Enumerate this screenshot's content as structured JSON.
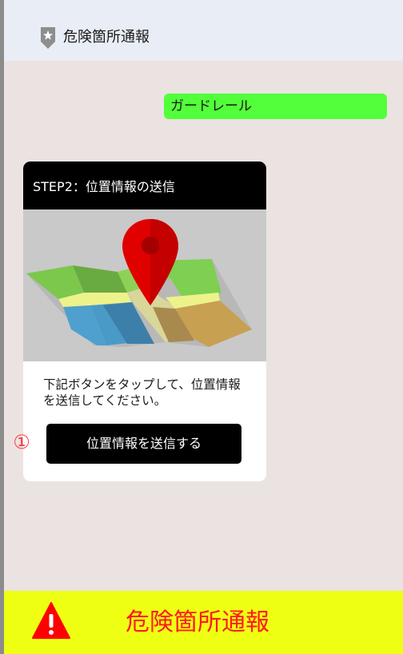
{
  "header": {
    "icon": "location-pin-star-icon",
    "title": "危険箇所通報"
  },
  "chat": {
    "message": "ガードレール"
  },
  "card": {
    "title": "STEP2：位置情報の送信",
    "image": "map-with-location-pin-illustration",
    "body_text": "下記ボタンをタップして、位置情報を送信してください。",
    "button_label": "位置情報を送信する"
  },
  "step_marker": "①",
  "footer": {
    "icon": "warning-triangle-icon",
    "title": "危険箇所通報"
  },
  "colors": {
    "background": "#ebe3e2",
    "header_bg": "#e9edf5",
    "bubble_green": "#53ff3a",
    "footer_yellow": "#eeff14",
    "footer_text_red": "#ff1a1a",
    "pin_red": "#e00000"
  }
}
